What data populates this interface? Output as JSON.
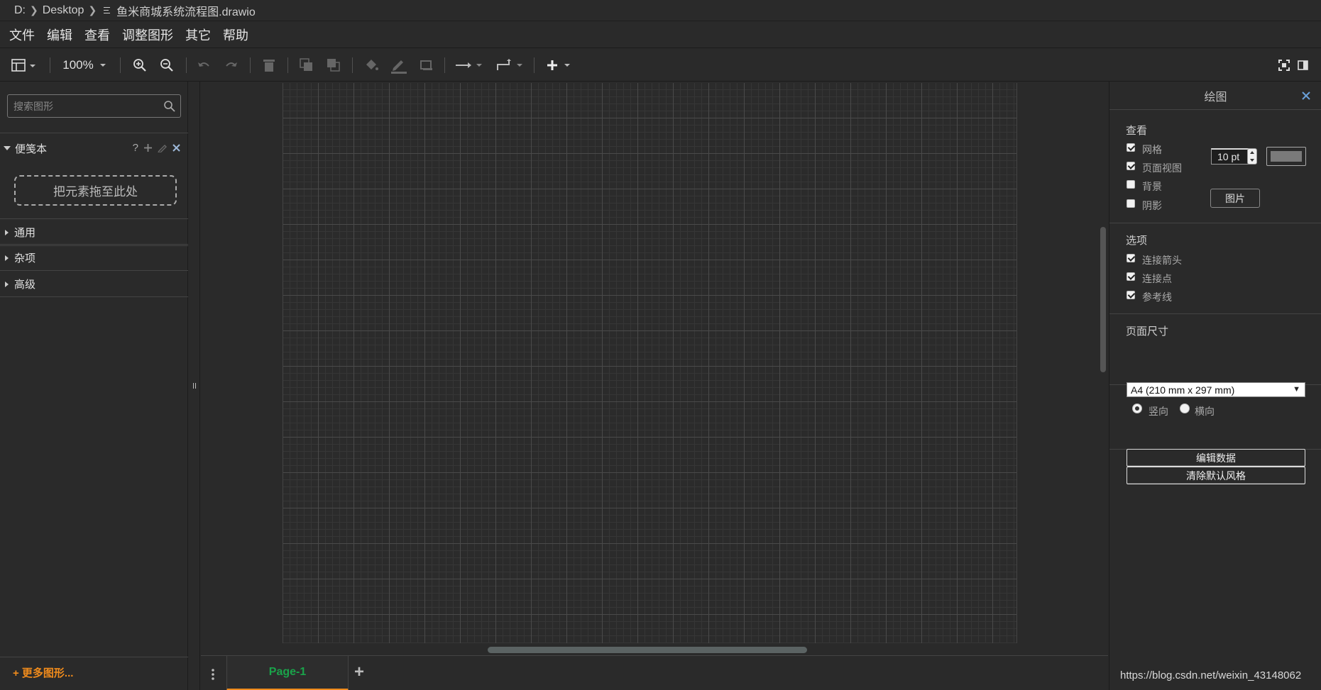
{
  "breadcrumb": {
    "drive": "D:",
    "folder": "Desktop",
    "file": "鱼米商城系统流程图.drawio"
  },
  "menu": [
    "文件",
    "编辑",
    "查看",
    "调整图形",
    "其它",
    "帮助"
  ],
  "toolbar": {
    "zoom": "100%"
  },
  "sidebar": {
    "search_placeholder": "搜索图形",
    "scratchpad": {
      "title": "便笺本",
      "help": "?",
      "dropzone": "把元素拖至此处"
    },
    "sections": [
      "通用",
      "杂项",
      "高级"
    ],
    "more_shapes": "+ 更多图形..."
  },
  "pages": {
    "active": "Page-1",
    "add": "+"
  },
  "format_panel": {
    "title": "绘图",
    "view": {
      "heading": "查看",
      "grid": {
        "label": "网格",
        "checked": true,
        "size": "10 pt",
        "color": "#7a7a7a"
      },
      "page_view": {
        "label": "页面视图",
        "checked": true
      },
      "background": {
        "label": "背景",
        "checked": false,
        "button": "图片"
      },
      "shadow": {
        "label": "阴影",
        "checked": false
      }
    },
    "options": {
      "heading": "选项",
      "connection_arrows": {
        "label": "连接箭头",
        "checked": true
      },
      "connection_points": {
        "label": "连接点",
        "checked": true
      },
      "guides": {
        "label": "参考线",
        "checked": true
      }
    },
    "paper": {
      "heading": "页面尺寸",
      "size": "A4 (210 mm x 297 mm)",
      "portrait": "竖向",
      "landscape": "横向",
      "orientation": "portrait"
    },
    "buttons": {
      "edit_data": "编辑数据",
      "clear_default_style": "清除默认风格"
    }
  },
  "watermark": "https://blog.csdn.net/weixin_43148062"
}
